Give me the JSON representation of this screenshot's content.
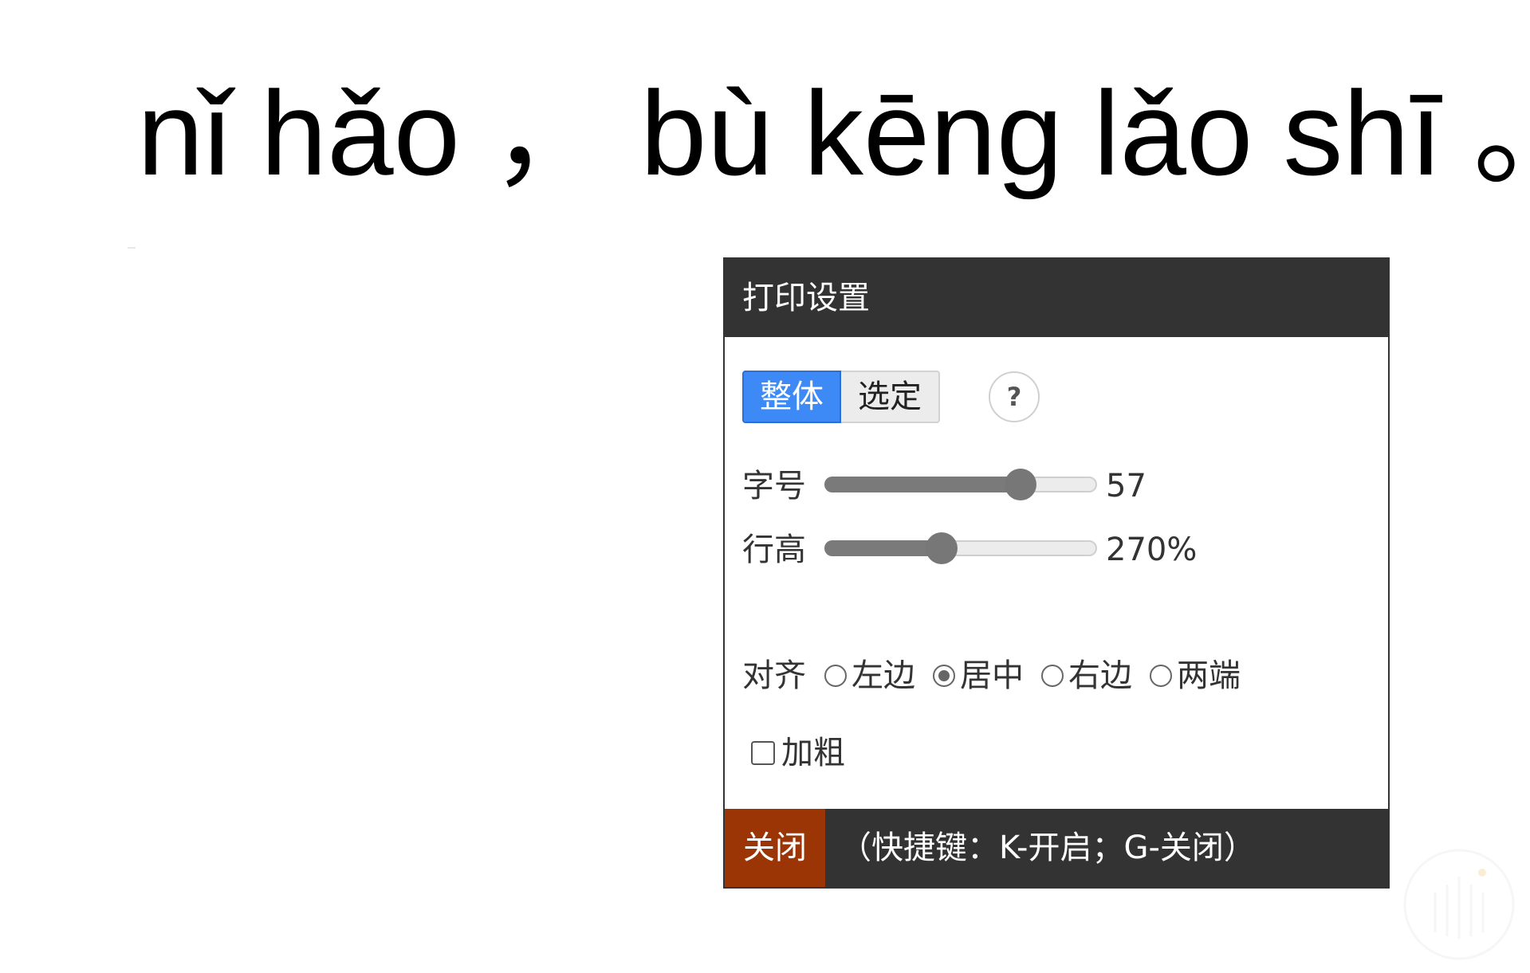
{
  "pinyin": {
    "syllables_first": [
      "nǐ",
      "hǎo"
    ],
    "comma": "，",
    "syllables_second": [
      "bù",
      "kēng",
      "lǎo",
      "shī"
    ],
    "period": "。"
  },
  "print_panel": {
    "title": "打印设置",
    "scope_tabs": [
      {
        "label": "整体",
        "active": true
      },
      {
        "label": "选定",
        "active": false
      }
    ],
    "help_label": "?",
    "font_size": {
      "label": "字号",
      "value_text": "57",
      "position_fraction": 0.72
    },
    "line_height": {
      "label": "行高",
      "value_text": "270%",
      "position_fraction": 0.43
    },
    "alignment": {
      "label": "对齐",
      "options": [
        "左边",
        "居中",
        "右边",
        "两端"
      ],
      "selected": "居中"
    },
    "bold": {
      "label": "加粗",
      "checked": false
    },
    "close_label": "关闭",
    "shortcut_hint": "（快捷键：K-开启；G-关闭）"
  },
  "colors": {
    "header_bg": "#333333",
    "active_tab": "#3d8af7",
    "close_button": "#9b3506"
  }
}
